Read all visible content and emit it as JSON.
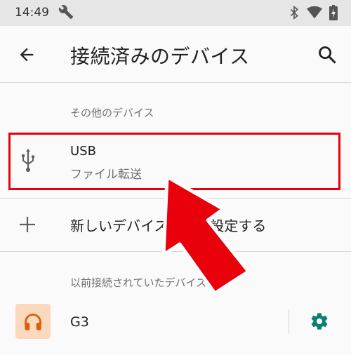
{
  "status_bar": {
    "time": "14:49",
    "icons": [
      "wrench-icon",
      "bluetooth-icon",
      "wifi-icon",
      "battery-charging-icon"
    ]
  },
  "app_bar": {
    "title": "接続済みのデバイス",
    "back_icon": "arrow-back-icon",
    "search_icon": "search-icon"
  },
  "other_devices": {
    "header": "その他のデバイス",
    "usb": {
      "name": "USB",
      "subtitle": "ファイル転送",
      "icon": "usb-icon"
    }
  },
  "pair_new": {
    "label": "新しいデバイスとペア設定する",
    "icon": "plus-icon"
  },
  "previous_devices": {
    "header": "以前接続されていたデバイス",
    "items": [
      {
        "name": "G3",
        "icon": "headset-icon",
        "action_icon": "gear-icon"
      }
    ]
  },
  "colors": {
    "highlight": "#e8000b",
    "accent": "#0a8074",
    "avatar_bg": "#fbd9bf",
    "avatar_icon": "#d95e0a"
  }
}
